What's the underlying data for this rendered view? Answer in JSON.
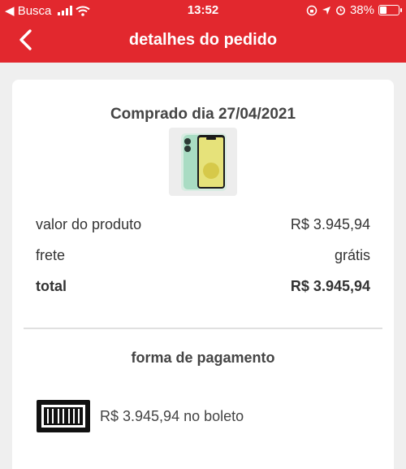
{
  "status_bar": {
    "carrier": "◀ Busca",
    "time": "13:52",
    "battery_text": "38%",
    "battery_level": 0.38
  },
  "header": {
    "title": "detalhes do pedido",
    "back_icon": "chevron-left-icon"
  },
  "order": {
    "purchased_label": "Comprado dia 27/04/2021",
    "product_image": "phone-image"
  },
  "summary": {
    "rows": [
      {
        "label": "valor do produto",
        "value": "R$ 3.945,94"
      },
      {
        "label": "frete",
        "value": "grátis"
      },
      {
        "label": "total",
        "value": "R$ 3.945,94"
      }
    ]
  },
  "payment": {
    "title": "forma de pagamento",
    "method_icon": "barcode-icon",
    "method_text": "R$ 3.945,94 no boleto"
  },
  "colors": {
    "brand": "#e2282e",
    "background": "#efefef",
    "card": "#ffffff",
    "text": "#333333"
  }
}
